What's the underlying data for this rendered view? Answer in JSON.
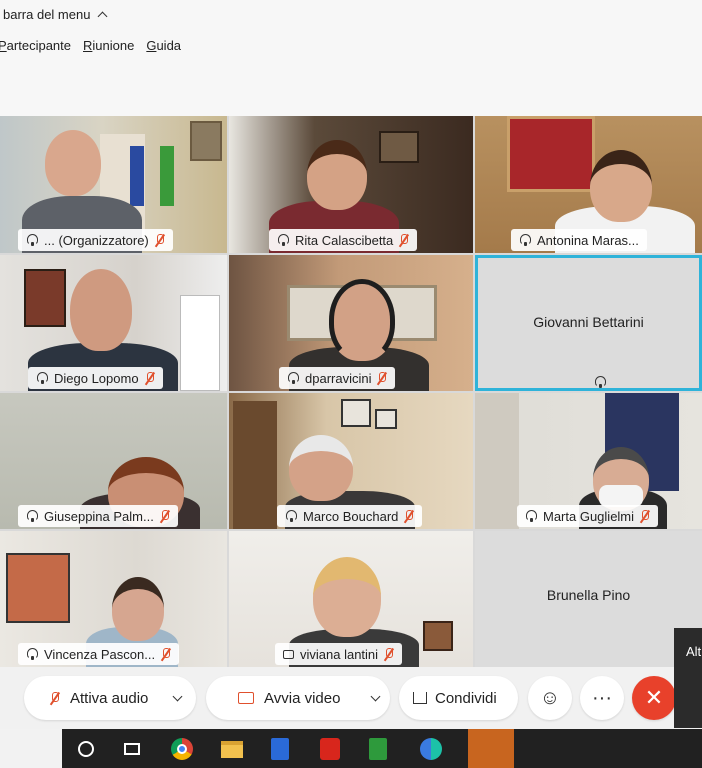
{
  "menubar": {
    "toggle_label": "barra del menu"
  },
  "menu": {
    "items": [
      "Partecipante",
      "Riunione",
      "Guida"
    ]
  },
  "participants": [
    {
      "name": "... (Organizzatore)"
    },
    {
      "name": "Rita Calascibetta"
    },
    {
      "name": "Antonina Maras..."
    },
    {
      "name": "Diego Lopomo"
    },
    {
      "name": "dparravicini"
    },
    {
      "name": "Giovanni Bettarini"
    },
    {
      "name": "Giuseppina Palm..."
    },
    {
      "name": "Marco Bouchard"
    },
    {
      "name": "Marta Guglielmi"
    },
    {
      "name": "Vincenza Pascon..."
    },
    {
      "name": "viviana lantini"
    },
    {
      "name": "Brunella Pino"
    }
  ],
  "controls": {
    "audio_label": "Attiva audio",
    "video_label": "Avvia video",
    "share_label": "Condividi"
  },
  "popup": {
    "text": "Alt"
  },
  "colors": {
    "end_call": "#e8412b",
    "active_speaker_border": "#2fb3d9",
    "mute_icon": "#e0502d"
  },
  "taskbar": {
    "icons": [
      "start-circle-icon",
      "task-view-icon",
      "chrome-icon",
      "file-explorer-icon",
      "word-doc-icon",
      "acrobat-icon",
      "spreadsheet-icon",
      "webex-icon"
    ]
  }
}
